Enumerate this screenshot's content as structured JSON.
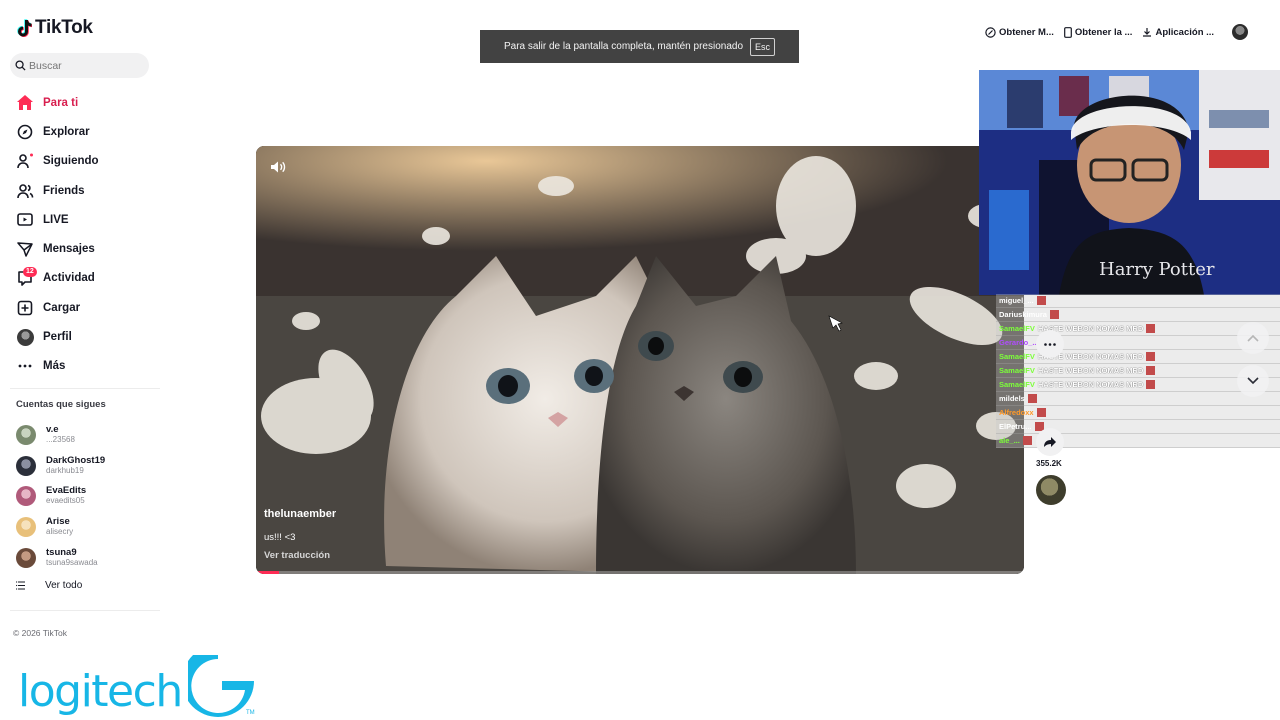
{
  "app": {
    "logo_text": "TikTok"
  },
  "search": {
    "placeholder": "Buscar"
  },
  "nav": {
    "items": [
      {
        "label": "Para ti",
        "icon": "home-icon",
        "active": true
      },
      {
        "label": "Explorar",
        "icon": "compass-icon"
      },
      {
        "label": "Siguiendo",
        "icon": "following-icon"
      },
      {
        "label": "Friends",
        "icon": "friends-icon"
      },
      {
        "label": "LIVE",
        "icon": "live-icon"
      },
      {
        "label": "Mensajes",
        "icon": "messages-icon"
      },
      {
        "label": "Actividad",
        "icon": "activity-icon",
        "badge": "12"
      },
      {
        "label": "Cargar",
        "icon": "upload-icon"
      },
      {
        "label": "Perfil",
        "icon": "profile-avatar"
      },
      {
        "label": "Más",
        "icon": "more-icon"
      }
    ]
  },
  "following": {
    "title": "Cuentas que sigues",
    "accounts": [
      {
        "name": "v.e",
        "handle": "...23568",
        "color": "#7a8a6e"
      },
      {
        "name": "DarkGhost19",
        "handle": "darkhub19",
        "color": "#2b2f3a"
      },
      {
        "name": "EvaEdits",
        "handle": "evaedits05",
        "color": "#b05a7a"
      },
      {
        "name": "Arise",
        "handle": "alisecry",
        "color": "#e8c07a"
      },
      {
        "name": "tsuna9",
        "handle": "tsuna9sawada",
        "color": "#6a4a3a"
      }
    ],
    "see_all": "Ver todo"
  },
  "footer": {
    "copyright": "© 2026 TikTok"
  },
  "overlay_brand": {
    "text": "logitech",
    "color": "#17b6e6"
  },
  "fullscreen_toast": {
    "message": "Para salir de la pantalla completa, mantén presionado",
    "key": "Esc"
  },
  "header": {
    "buttons": [
      {
        "label": "Obtener M...",
        "icon": "coin-icon"
      },
      {
        "label": "Obtener la ...",
        "icon": "phone-icon"
      },
      {
        "label": "Aplicación ...",
        "icon": "download-icon"
      }
    ]
  },
  "video": {
    "author": "thelunaember",
    "caption": "us!!! <3",
    "translate_label": "Ver traducción",
    "progress": 0.03
  },
  "chat": {
    "messages": [
      {
        "user": "miguel_...",
        "text": "",
        "color": "#ffffff"
      },
      {
        "user": "Dariuskimura",
        "text": "",
        "color": "#ffffff"
      },
      {
        "user": "SamaelFV",
        "text": "HASTE WEBON NOMAS MRD",
        "color": "#7dff3a"
      },
      {
        "user": "Gerardo_...",
        "text": "",
        "color": "#b14cff"
      },
      {
        "user": "SamaelFV",
        "text": "HASTE WEBON NOMAS MRD",
        "color": "#7dff3a"
      },
      {
        "user": "SamaelFV",
        "text": "HASTE WEBON NOMAS MRD",
        "color": "#7dff3a"
      },
      {
        "user": "SamaelFV",
        "text": "HASTE WEBON NOMAS MRD",
        "color": "#7dff3a"
      },
      {
        "user": "mildels",
        "text": "",
        "color": "#ffffff"
      },
      {
        "user": "Alfredoxx",
        "text": "",
        "color": "#ff9a2a"
      },
      {
        "user": "ElPetru...",
        "text": "",
        "color": "#ffffff"
      },
      {
        "user": "ale_...",
        "text": "",
        "color": "#7dff3a"
      }
    ]
  },
  "actions": {
    "share_count": "355.2K"
  }
}
